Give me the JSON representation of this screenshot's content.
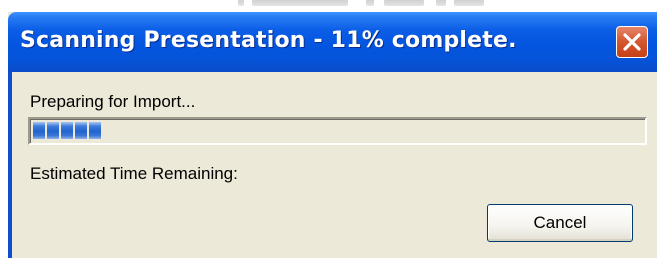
{
  "window": {
    "title": "Scanning Presentation - 11% complete.",
    "close_icon": "close-icon"
  },
  "progress": {
    "status_text": "Preparing for Import...",
    "percent": 11,
    "estimate_label": "Estimated Time Remaining:"
  },
  "buttons": {
    "cancel_label": "Cancel"
  },
  "colors": {
    "title_bar": "#0455e0",
    "close_button": "#d45a33",
    "progress_fill": "#2163cf",
    "window_face": "#ece9d8"
  }
}
